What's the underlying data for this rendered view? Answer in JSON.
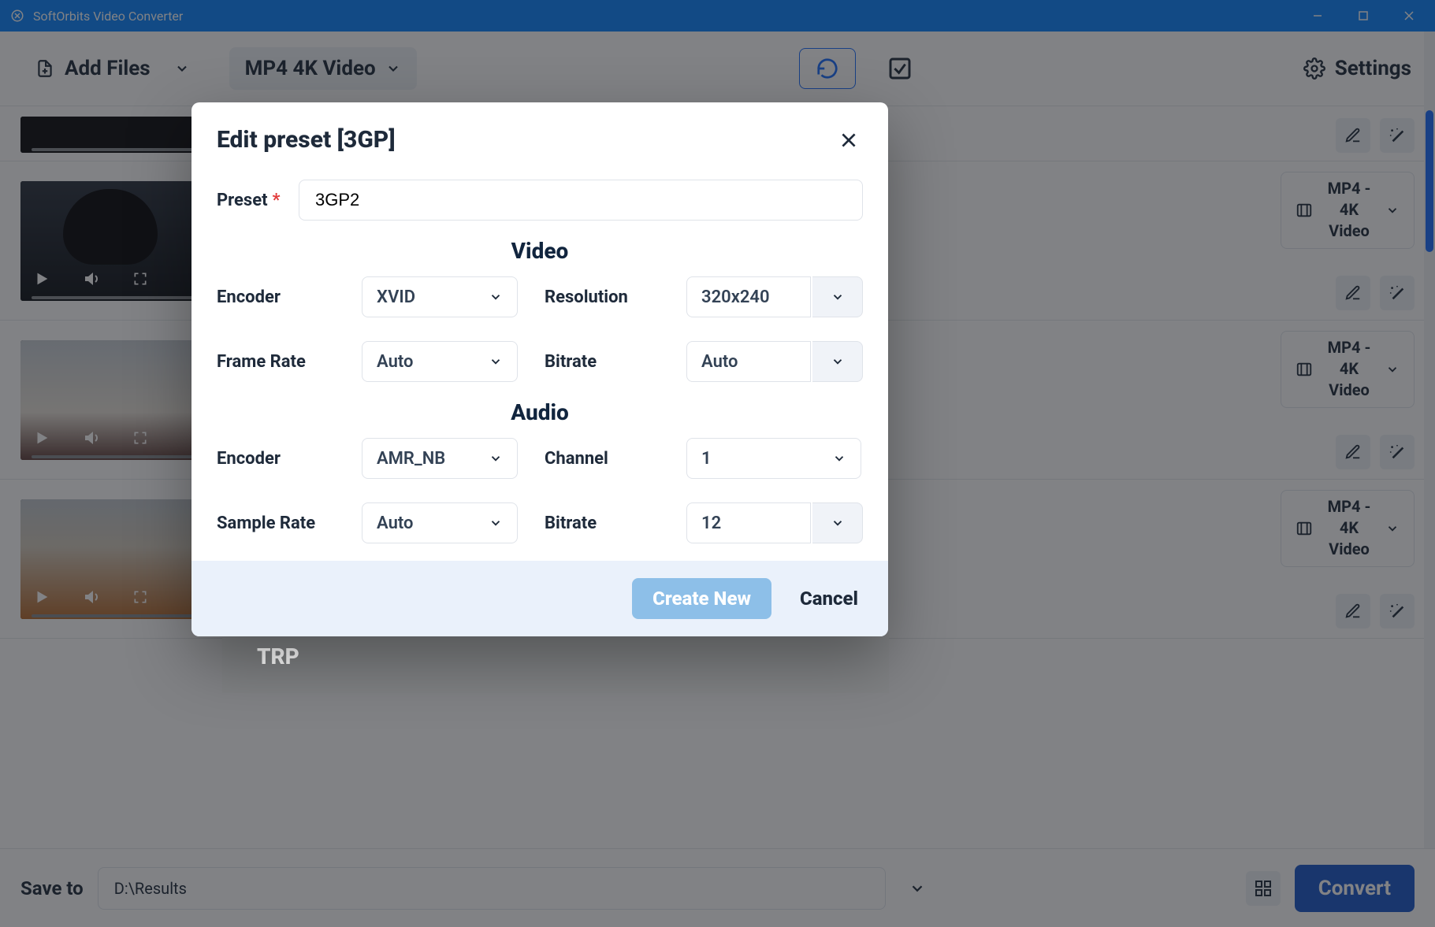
{
  "titlebar": {
    "title": "SoftOrbits Video Converter"
  },
  "toolbar": {
    "add_files": "Add Files",
    "preset": "MP4 4K Video",
    "settings": "Settings"
  },
  "files": {
    "format_label": "MP4 - 4K Video"
  },
  "dd_residual": {
    "label": "TRP"
  },
  "bottom": {
    "save_to": "Save to",
    "path": "D:\\Results",
    "convert": "Convert"
  },
  "modal": {
    "title": "Edit preset [3GP]",
    "preset_label": "Preset",
    "preset_value": "3GP2",
    "video_section": "Video",
    "audio_section": "Audio",
    "video": {
      "encoder_label": "Encoder",
      "encoder_value": "XVID",
      "resolution_label": "Resolution",
      "resolution_value": "320x240",
      "framerate_label": "Frame Rate",
      "framerate_value": "Auto",
      "bitrate_label": "Bitrate",
      "bitrate_value": "Auto"
    },
    "audio": {
      "encoder_label": "Encoder",
      "encoder_value": "AMR_NB",
      "channel_label": "Channel",
      "channel_value": "1",
      "samplerate_label": "Sample Rate",
      "samplerate_value": "Auto",
      "bitrate_label": "Bitrate",
      "bitrate_value": "12"
    },
    "create": "Create New",
    "cancel": "Cancel"
  }
}
